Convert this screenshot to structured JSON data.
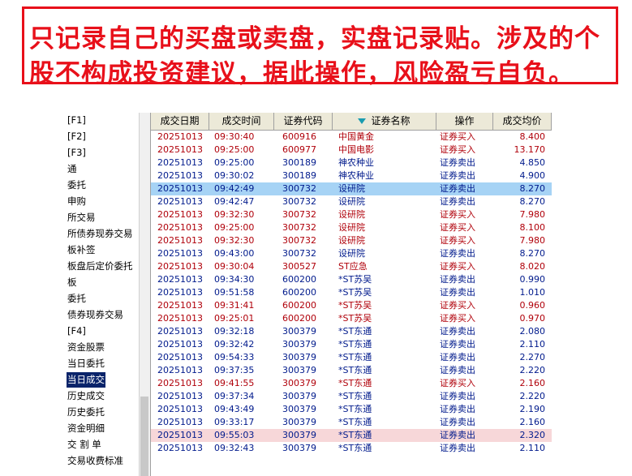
{
  "banner": {
    "line1": "只记录自己的买盘或卖盘，实盘记录贴。涉及的个",
    "line2": "股不构成投资建议，据此操作，风险盈亏自负。"
  },
  "sidebar": {
    "items": [
      {
        "label": "[F1]"
      },
      {
        "label": "[F2]"
      },
      {
        "label": "[F3]"
      },
      {
        "label": "通"
      },
      {
        "label": "委托"
      },
      {
        "label": "申购"
      },
      {
        "label": "所交易"
      },
      {
        "label": "所债券现券交易"
      },
      {
        "label": "板补签"
      },
      {
        "label": "板盘后定价委托"
      },
      {
        "label": "板"
      },
      {
        "label": "委托"
      },
      {
        "label": "债券现券交易"
      },
      {
        "label": "[F4]"
      },
      {
        "label": "资金股票"
      },
      {
        "label": "当日委托"
      },
      {
        "label": "当日成交"
      },
      {
        "label": "历史成交"
      },
      {
        "label": "历史委托"
      },
      {
        "label": "资金明细"
      },
      {
        "label": "交 割 单"
      },
      {
        "label": "交易收费标准"
      }
    ]
  },
  "table": {
    "columns": [
      "成交日期",
      "成交时间",
      "证券代码",
      "证券名称",
      "操作",
      "成交均价"
    ],
    "rows": [
      {
        "date": "20251013",
        "time": "09:30:40",
        "code": "600916",
        "name": "中国黄金",
        "op": "证券买入",
        "price": "8.400",
        "side": "buy"
      },
      {
        "date": "20251013",
        "time": "09:25:00",
        "code": "600977",
        "name": "中国电影",
        "op": "证券买入",
        "price": "13.170",
        "side": "buy"
      },
      {
        "date": "20251013",
        "time": "09:25:00",
        "code": "300189",
        "name": "神农种业",
        "op": "证券卖出",
        "price": "4.850",
        "side": "sell"
      },
      {
        "date": "20251013",
        "time": "09:30:02",
        "code": "300189",
        "name": "神农种业",
        "op": "证券卖出",
        "price": "4.900",
        "side": "sell"
      },
      {
        "date": "20251013",
        "time": "09:42:49",
        "code": "300732",
        "name": "设研院",
        "op": "证券卖出",
        "price": "8.270",
        "side": "sell"
      },
      {
        "date": "20251013",
        "time": "09:42:47",
        "code": "300732",
        "name": "设研院",
        "op": "证券卖出",
        "price": "8.270",
        "side": "sell"
      },
      {
        "date": "20251013",
        "time": "09:32:30",
        "code": "300732",
        "name": "设研院",
        "op": "证券买入",
        "price": "7.980",
        "side": "buy"
      },
      {
        "date": "20251013",
        "time": "09:25:00",
        "code": "300732",
        "name": "设研院",
        "op": "证券买入",
        "price": "8.100",
        "side": "buy"
      },
      {
        "date": "20251013",
        "time": "09:32:30",
        "code": "300732",
        "name": "设研院",
        "op": "证券买入",
        "price": "7.980",
        "side": "buy"
      },
      {
        "date": "20251013",
        "time": "09:43:00",
        "code": "300732",
        "name": "设研院",
        "op": "证券卖出",
        "price": "8.270",
        "side": "sell"
      },
      {
        "date": "20251013",
        "time": "09:30:04",
        "code": "300527",
        "name": "ST应急",
        "op": "证券买入",
        "price": "8.020",
        "side": "buy"
      },
      {
        "date": "20251013",
        "time": "09:34:30",
        "code": "600200",
        "name": "*ST苏吴",
        "op": "证券卖出",
        "price": "0.990",
        "side": "sell"
      },
      {
        "date": "20251013",
        "time": "09:51:58",
        "code": "600200",
        "name": "*ST苏吴",
        "op": "证券卖出",
        "price": "1.010",
        "side": "sell"
      },
      {
        "date": "20251013",
        "time": "09:31:41",
        "code": "600200",
        "name": "*ST苏吴",
        "op": "证券买入",
        "price": "0.960",
        "side": "buy"
      },
      {
        "date": "20251013",
        "time": "09:25:01",
        "code": "600200",
        "name": "*ST苏吴",
        "op": "证券买入",
        "price": "0.970",
        "side": "buy"
      },
      {
        "date": "20251013",
        "time": "09:32:18",
        "code": "300379",
        "name": "*ST东通",
        "op": "证券卖出",
        "price": "2.080",
        "side": "sell"
      },
      {
        "date": "20251013",
        "time": "09:32:42",
        "code": "300379",
        "name": "*ST东通",
        "op": "证券卖出",
        "price": "2.110",
        "side": "sell"
      },
      {
        "date": "20251013",
        "time": "09:54:33",
        "code": "300379",
        "name": "*ST东通",
        "op": "证券卖出",
        "price": "2.270",
        "side": "sell"
      },
      {
        "date": "20251013",
        "time": "09:37:35",
        "code": "300379",
        "name": "*ST东通",
        "op": "证券卖出",
        "price": "2.220",
        "side": "sell"
      },
      {
        "date": "20251013",
        "time": "09:41:55",
        "code": "300379",
        "name": "*ST东通",
        "op": "证券买入",
        "price": "2.160",
        "side": "buy"
      },
      {
        "date": "20251013",
        "time": "09:37:34",
        "code": "300379",
        "name": "*ST东通",
        "op": "证券卖出",
        "price": "2.220",
        "side": "sell"
      },
      {
        "date": "20251013",
        "time": "09:43:49",
        "code": "300379",
        "name": "*ST东通",
        "op": "证券卖出",
        "price": "2.190",
        "side": "sell"
      },
      {
        "date": "20251013",
        "time": "09:33:17",
        "code": "300379",
        "name": "*ST东通",
        "op": "证券卖出",
        "price": "2.160",
        "side": "sell"
      },
      {
        "date": "20251013",
        "time": "09:55:03",
        "code": "300379",
        "name": "*ST东通",
        "op": "证券卖出",
        "price": "2.320",
        "side": "sell"
      },
      {
        "date": "20251013",
        "time": "09:32:43",
        "code": "300379",
        "name": "*ST东通",
        "op": "证券卖出",
        "price": "2.110",
        "side": "sell"
      }
    ]
  },
  "colors": {
    "banner_red": "#e8101a",
    "buy": "#b0000a",
    "sell": "#001a8c",
    "selected_row": "#a6d3f5",
    "highlight_row": "#f7d7d9",
    "active_menu": "#0a246a"
  },
  "icons": {
    "sort": "sort-down-triangle-icon"
  }
}
